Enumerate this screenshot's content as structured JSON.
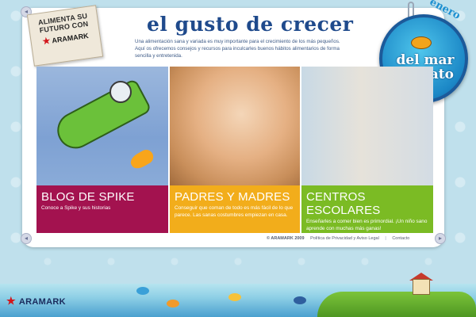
{
  "badge": {
    "lines": [
      "ALIMENTA SU",
      "FUTURO CON"
    ],
    "logo": "ARAMARK"
  },
  "header": {
    "title": "el gusto de crecer",
    "intro": "Una alimentación sana y variada es muy importante para el crecimiento de los más pequeños. Aquí os ofrecemos consejos y recursos para inculcarles buenos hábitos alimentarios de forma sencilla y entretenida."
  },
  "medallion": {
    "month": "enero",
    "line1": "del mar",
    "line2": "al plato"
  },
  "panels": [
    {
      "heading": "BLOG DE SPIKE",
      "desc": "Conoce a Spike y sus historias",
      "color": "#a3124f"
    },
    {
      "heading": "PADRES Y MADRES",
      "desc": "Conseguir que coman de todo es más fácil de lo que parece. Las sanas costumbres empiezan en casa.",
      "color": "#f2ad1b"
    },
    {
      "heading": "CENTROS ESCOLARES",
      "desc": "Enseñarles a comer bien es primordial. ¡Un niño sano aprende con muchas más ganas!",
      "color": "#7bbb24"
    }
  ],
  "footer": {
    "copyright": "© ARAMARK 2009",
    "privacy": "Política de Privacidad y Aviso Legal",
    "separator": "|",
    "contact": "Contacto"
  },
  "bottom_logo": "ARAMARK",
  "icons": {
    "star": "aramark-star-icon",
    "corner": "nav-circle-icon"
  }
}
